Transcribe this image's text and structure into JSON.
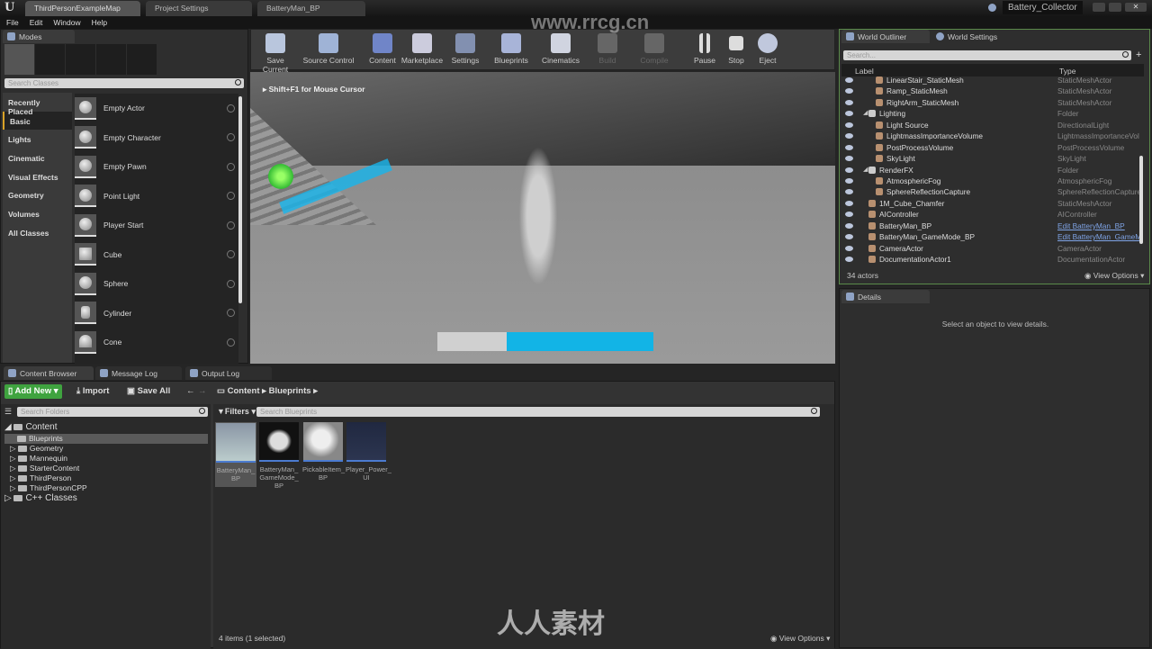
{
  "window": {
    "logo": "U",
    "tabs": [
      "ThirdPersonExampleMap",
      "Project Settings",
      "BatteryMan_BP"
    ],
    "project": "Battery_Collector",
    "watermark": "www.rrcg.cn",
    "bottom_watermark": "人人素材"
  },
  "menu": [
    "File",
    "Edit",
    "Window",
    "Help"
  ],
  "modes": {
    "tab": "Modes",
    "search_placeholder": "Search Classes",
    "categories": [
      "Recently Placed",
      "Basic",
      "Lights",
      "Cinematic",
      "Visual Effects",
      "Geometry",
      "Volumes",
      "All Classes"
    ],
    "selected_category": "Basic",
    "items": [
      "Empty Actor",
      "Empty Character",
      "Empty Pawn",
      "Point Light",
      "Player Start",
      "Cube",
      "Sphere",
      "Cylinder",
      "Cone"
    ]
  },
  "toolbar": {
    "buttons": [
      "Save Current",
      "Source Control",
      "Content",
      "Marketplace",
      "Settings",
      "Blueprints",
      "Cinematics",
      "Build",
      "Compile",
      "Pause",
      "Stop",
      "Eject"
    ]
  },
  "viewport": {
    "hint": "Shift+F1 for Mouse Cursor",
    "power_fraction": 0.68,
    "colors": {
      "power": "#12b4e6",
      "empty": "#d0d0d0"
    }
  },
  "outliner": {
    "tabs": [
      "World Outliner",
      "World Settings"
    ],
    "search_placeholder": "Search...",
    "col_label": "Label",
    "col_type": "Type",
    "rows": [
      {
        "label": "LinearStair_StaticMesh",
        "type": "StaticMeshActor",
        "indent": 2
      },
      {
        "label": "Ramp_StaticMesh",
        "type": "StaticMeshActor",
        "indent": 2
      },
      {
        "label": "RightArm_StaticMesh",
        "type": "StaticMeshActor",
        "indent": 2
      },
      {
        "label": "Lighting",
        "type": "Folder",
        "indent": 1,
        "folder": true
      },
      {
        "label": "Light Source",
        "type": "DirectionalLight",
        "indent": 2
      },
      {
        "label": "LightmassImportanceVolume",
        "type": "LightmassImportanceVol",
        "indent": 2
      },
      {
        "label": "PostProcessVolume",
        "type": "PostProcessVolume",
        "indent": 2
      },
      {
        "label": "SkyLight",
        "type": "SkyLight",
        "indent": 2
      },
      {
        "label": "RenderFX",
        "type": "Folder",
        "indent": 1,
        "folder": true
      },
      {
        "label": "AtmosphericFog",
        "type": "AtmosphericFog",
        "indent": 2
      },
      {
        "label": "SphereReflectionCapture",
        "type": "SphereReflectionCapture",
        "indent": 2
      },
      {
        "label": "1M_Cube_Chamfer",
        "type": "StaticMeshActor",
        "indent": 1
      },
      {
        "label": "AIController",
        "type": "AIController",
        "indent": 1
      },
      {
        "label": "BatteryMan_BP",
        "type": "Edit BatteryMan_BP",
        "indent": 1,
        "link": true
      },
      {
        "label": "BatteryMan_GameMode_BP",
        "type": "Edit BatteryMan_GameM",
        "indent": 1,
        "link": true
      },
      {
        "label": "CameraActor",
        "type": "CameraActor",
        "indent": 1
      },
      {
        "label": "DocumentationActor1",
        "type": "DocumentationActor",
        "indent": 1
      }
    ],
    "count": "34 actors",
    "view_options": "View Options"
  },
  "details": {
    "tab": "Details",
    "empty": "Select an object to view details."
  },
  "bottom_tabs": [
    "Content Browser",
    "Message Log",
    "Output Log"
  ],
  "content": {
    "add_new": "Add New",
    "import": "Import",
    "save_all": "Save All",
    "path": [
      "Content",
      "Blueprints"
    ],
    "folder_search": "Search Folders",
    "filters": "Filters",
    "asset_search": "Search Blueprints",
    "tree_root": "Content",
    "tree": [
      "Blueprints",
      "Geometry",
      "Mannequin",
      "StarterContent",
      "ThirdPerson",
      "ThirdPersonCPP"
    ],
    "selected_folder": "Blueprints",
    "cpp": "C++ Classes",
    "assets": [
      "BatteryMan_ BP",
      "BatteryMan_ GameMode_ BP",
      "PickableItem_ BP",
      "Player_Power_ UI"
    ],
    "status": "4 items (1 selected)",
    "view_options": "View Options"
  }
}
